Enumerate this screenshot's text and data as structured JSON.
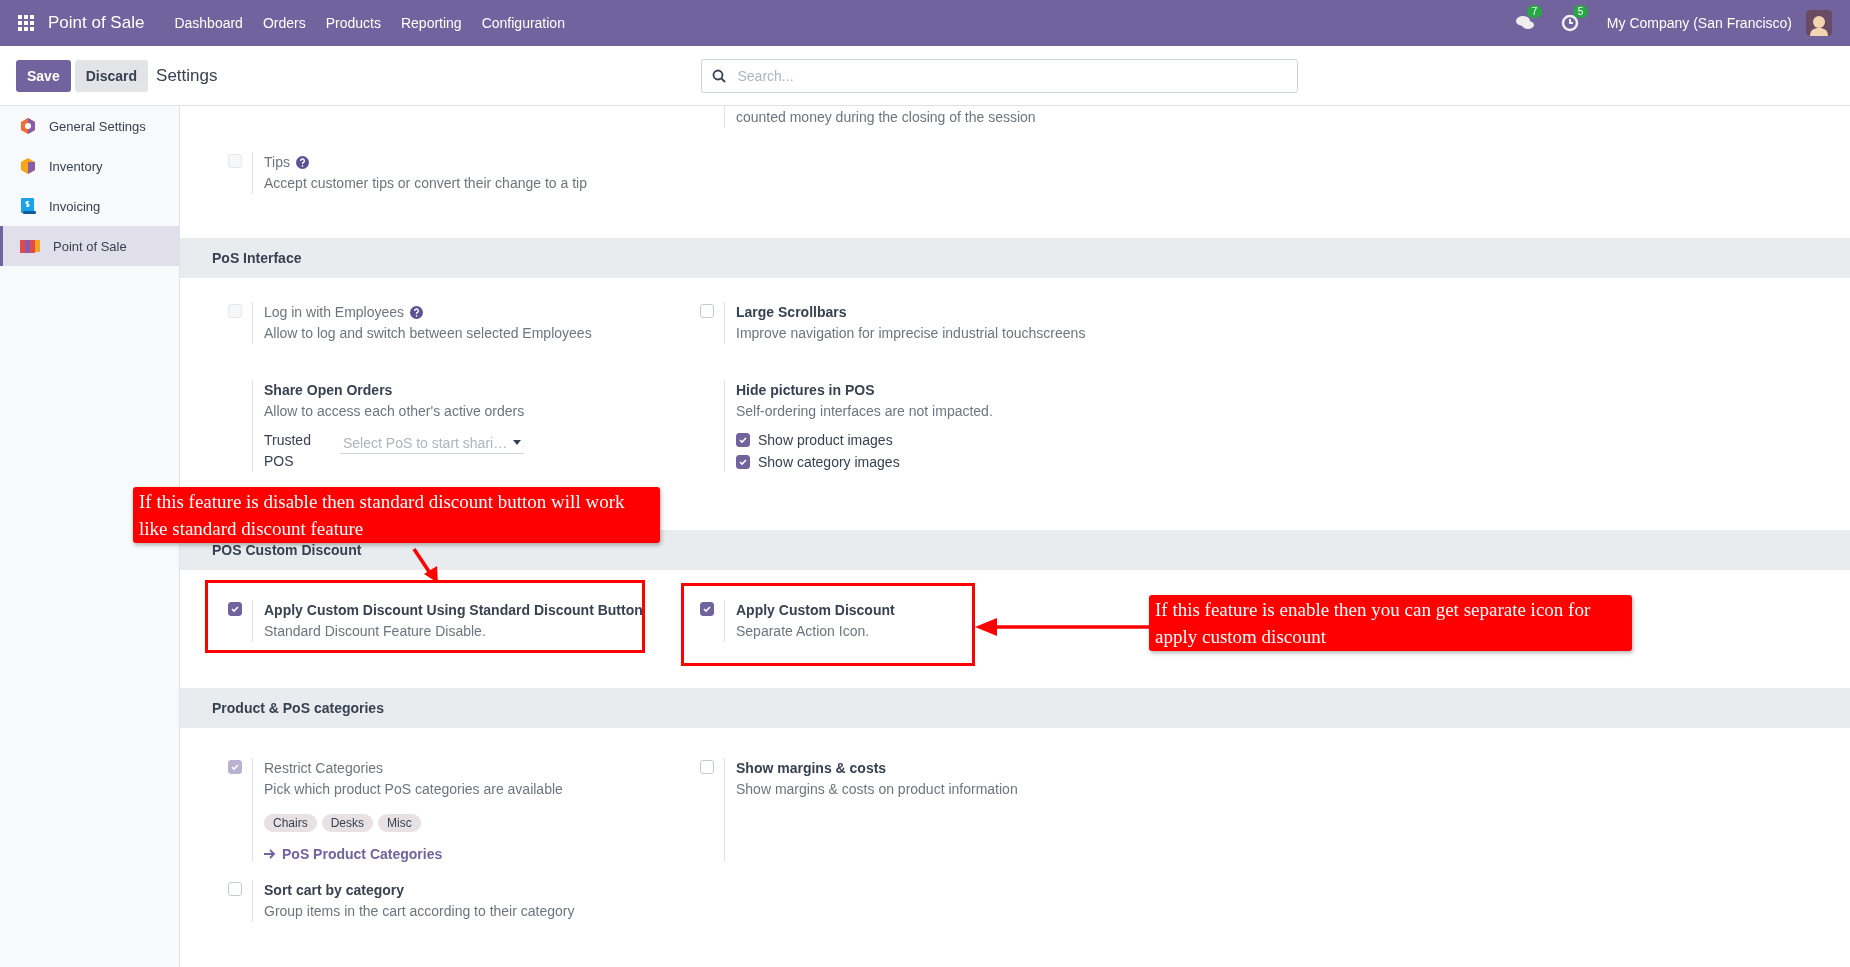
{
  "top_bar": {
    "app_title": "Point of Sale",
    "menu": [
      "Dashboard",
      "Orders",
      "Products",
      "Reporting",
      "Configuration"
    ],
    "messages_count": "7",
    "activities_count": "5",
    "company": "My Company (San Francisco)"
  },
  "control_bar": {
    "save": "Save",
    "discard": "Discard",
    "breadcrumb": "Settings",
    "search": {
      "placeholder": "Search..."
    }
  },
  "sidebar": {
    "items": [
      {
        "label": "General Settings",
        "selected": false
      },
      {
        "label": "Inventory",
        "selected": false
      },
      {
        "label": "Invoicing",
        "selected": false
      },
      {
        "label": "Point of Sale",
        "selected": true
      }
    ]
  },
  "sections": [
    {
      "settings": [
        {
          "kind": "fragment",
          "description": "counted money during the closing of the session"
        },
        {
          "kind": "checkbox",
          "label": "Tips",
          "help": true,
          "disabled": true,
          "checked": false,
          "description": "Accept customer tips or convert their change to a tip"
        }
      ]
    },
    {
      "title": "PoS Interface",
      "settings": [
        {
          "kind": "checkbox",
          "label": "Log in with Employees",
          "help": true,
          "disabled": true,
          "checked": false,
          "description": "Allow to log and switch between selected Employees"
        },
        {
          "kind": "checkbox",
          "label": "Large Scrollbars",
          "disabled": false,
          "checked": false,
          "description": "Improve navigation for imprecise industrial touchscreens"
        },
        {
          "kind": "plain",
          "label": "Share Open Orders",
          "description": "Allow to access each other's active orders",
          "field": {
            "label": "Trusted POS",
            "placeholder": "Select PoS to start shari…"
          }
        },
        {
          "kind": "plain",
          "label": "Hide pictures in POS",
          "description": "Self-ordering interfaces are not impacted.",
          "options": [
            {
              "label": "Show product images",
              "checked": true
            },
            {
              "label": "Show category images",
              "checked": true
            }
          ]
        }
      ]
    },
    {
      "title": "POS Custom Discount",
      "settings": [
        {
          "kind": "checkbox",
          "label": "Apply Custom Discount Using Standard Discount Button",
          "disabled": false,
          "checked": true,
          "description": "Standard Discount Feature Disable."
        },
        {
          "kind": "checkbox",
          "label": "Apply Custom Discount",
          "disabled": false,
          "checked": true,
          "description": "Separate Action Icon."
        }
      ]
    },
    {
      "title": "Product & PoS categories",
      "settings": [
        {
          "kind": "checkbox",
          "label": "Restrict Categories",
          "disabled": true,
          "checked": true,
          "description": "Pick which product PoS categories are available",
          "tags": [
            "Chairs",
            "Desks",
            "Misc"
          ],
          "link": "PoS Product Categories"
        },
        {
          "kind": "checkbox",
          "label": "Show margins & costs",
          "disabled": false,
          "checked": false,
          "description": "Show margins & costs on product information"
        },
        {
          "kind": "checkbox",
          "label": "Sort cart by category",
          "disabled": false,
          "checked": false,
          "description": "Group items in the cart according to their category"
        }
      ]
    }
  ],
  "annotations": [
    {
      "kind": "callout",
      "text": "If this feature is disable then standard discount button will work like standard discount feature"
    },
    {
      "kind": "frame"
    },
    {
      "kind": "frame"
    },
    {
      "kind": "callout",
      "text": "If this feature is enable then you can get separate icon for apply custom discount"
    },
    {
      "kind": "arrow"
    },
    {
      "kind": "arrow"
    }
  ]
}
